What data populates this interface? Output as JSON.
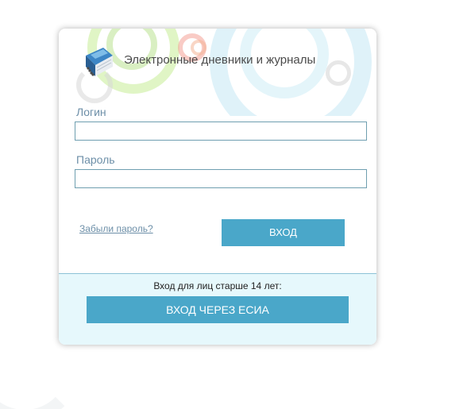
{
  "header": {
    "title": "Электронные дневники и журналы"
  },
  "form": {
    "login_label": "Логин",
    "login_value": "",
    "password_label": "Пароль",
    "password_value": "",
    "forgot_link": "Забыли пароль?",
    "submit_label": "ВХОД"
  },
  "esia": {
    "caption": "Вход для лиц старше 14 лет:",
    "button_label": "ВХОД ЧЕРЕЗ ЕСИА"
  },
  "colors": {
    "accent_button": "#4aa7c9",
    "label_text": "#6d8fa8",
    "esia_panel_bg": "#e6f8fc",
    "input_border": "#6f9fb0"
  },
  "icons": {
    "logo": "book-icon"
  }
}
